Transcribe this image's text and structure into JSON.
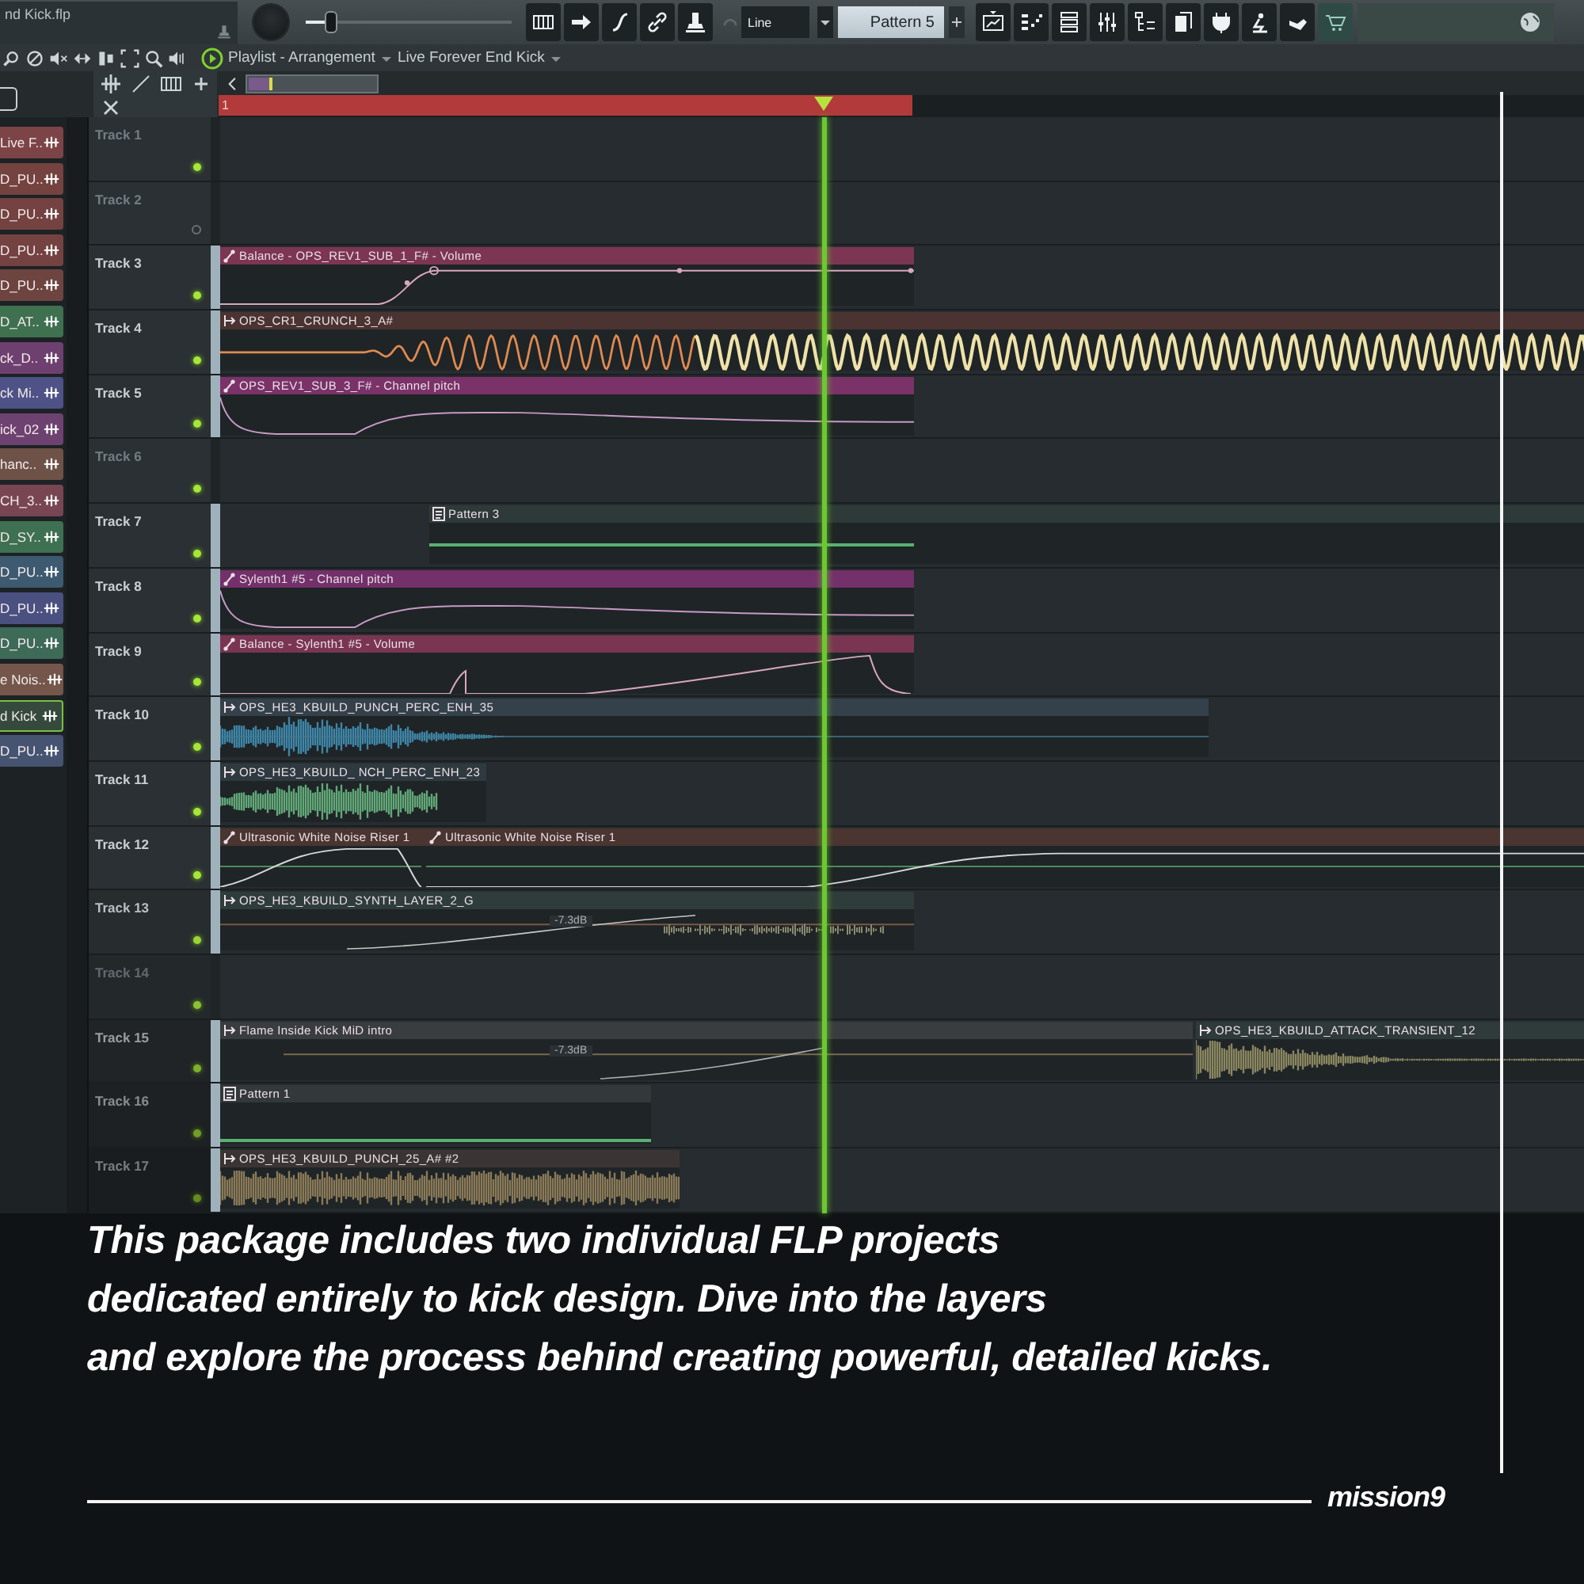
{
  "project": {
    "file_name": "nd Kick.flp"
  },
  "toolbar": {
    "slider": {
      "level": 0.12
    },
    "snap_mode": "Line",
    "pattern": "Pattern 5"
  },
  "playlist": {
    "title": "Playlist - Arrangement",
    "arrangement": "Live Forever End Kick",
    "ruler_label": "1"
  },
  "channels": [
    {
      "name": "Live F..",
      "color": "#7c4446",
      "selected": false
    },
    {
      "name": "D_PU..",
      "color": "#74423f",
      "selected": false
    },
    {
      "name": "D_PU..",
      "color": "#744240",
      "selected": false
    },
    {
      "name": "D_PU..",
      "color": "#744241",
      "selected": false
    },
    {
      "name": "D_PU..",
      "color": "#6e4440",
      "selected": false
    },
    {
      "name": "D_AT..",
      "color": "#3f7050",
      "selected": false
    },
    {
      "name": "ck_D..",
      "color": "#6e4070",
      "selected": false
    },
    {
      "name": "ck Mi..",
      "color": "#4e5286",
      "selected": false
    },
    {
      "name": "ick_02",
      "color": "#6e4270",
      "selected": false
    },
    {
      "name": "hanc..",
      "color": "#6e5248",
      "selected": false
    },
    {
      "name": "CH_3..",
      "color": "#784652",
      "selected": false
    },
    {
      "name": "D_SY..",
      "color": "#3e7052",
      "selected": false
    },
    {
      "name": "D_PU..",
      "color": "#3d5a70",
      "selected": false
    },
    {
      "name": "D_PU..",
      "color": "#4a5080",
      "selected": false
    },
    {
      "name": "D_PU..",
      "color": "#3e6a58",
      "selected": false
    },
    {
      "name": "e Nois..",
      "color": "#74564a",
      "selected": false
    },
    {
      "name": "d Kick",
      "color": "#354a3c",
      "selected": true
    },
    {
      "name": "D_PU..",
      "color": "#465472",
      "selected": false
    }
  ],
  "tracks": [
    {
      "name": "Track 1",
      "led_on": true
    },
    {
      "name": "Track 2",
      "led_on": false
    },
    {
      "name": "Track 3",
      "led_on": true,
      "clips": [
        {
          "kind": "automation",
          "label": "Balance - OPS_REV1_SUB_1_F# - Volume",
          "color": "#7c3552"
        }
      ]
    },
    {
      "name": "Track 4",
      "led_on": true,
      "clips": [
        {
          "kind": "audio",
          "label": "OPS_CR1_CRUNCH_3_A#",
          "color": "#4a3330"
        }
      ]
    },
    {
      "name": "Track 5",
      "led_on": true,
      "clips": [
        {
          "kind": "automation",
          "label": "OPS_REV1_SUB_3_F# - Channel pitch",
          "color": "#7a3268"
        }
      ]
    },
    {
      "name": "Track 6",
      "led_on": true
    },
    {
      "name": "Track 7",
      "led_on": true,
      "clips": [
        {
          "kind": "pattern",
          "label": "Pattern 3",
          "color": "#2e3a38"
        }
      ]
    },
    {
      "name": "Track 8",
      "led_on": true,
      "clips": [
        {
          "kind": "automation",
          "label": "Sylenth1 #5 - Channel pitch",
          "color": "#73306a"
        }
      ]
    },
    {
      "name": "Track 9",
      "led_on": true,
      "clips": [
        {
          "kind": "automation",
          "label": "Balance - Sylenth1 #5 - Volume",
          "color": "#7a3552"
        }
      ]
    },
    {
      "name": "Track 10",
      "led_on": true,
      "clips": [
        {
          "kind": "audio",
          "label": "OPS_HE3_KBUILD_PUNCH_PERC_ENH_35",
          "color": "#34414a"
        }
      ]
    },
    {
      "name": "Track 11",
      "led_on": true,
      "clips": [
        {
          "kind": "audio",
          "label": "OPS_HE3_KBUILD_ NCH_PERC_ENH_23",
          "color": "#2e3a40"
        }
      ]
    },
    {
      "name": "Track 12",
      "led_on": true,
      "clips": [
        {
          "kind": "automation",
          "label": "Ultrasonic White Noise Riser 1",
          "color": "#4a3530"
        },
        {
          "kind": "automation",
          "label": "Ultrasonic White Noise Riser 1",
          "color": "#4a3531"
        }
      ]
    },
    {
      "name": "Track 13",
      "led_on": true,
      "clips": [
        {
          "kind": "audio",
          "label": "OPS_HE3_KBUILD_SYNTH_LAYER_2_G",
          "color": "#2f3d3a",
          "gain": "-7.3dB"
        }
      ]
    },
    {
      "name": "Track 14",
      "led_on": true
    },
    {
      "name": "Track 15",
      "led_on": true,
      "clips": [
        {
          "kind": "audio",
          "label": "Flame Inside Kick MiD intro",
          "color": "#3a3d40",
          "gain": "-7.3dB"
        },
        {
          "kind": "audio",
          "label": "OPS_HE3_KBUILD_ATTACK_TRANSIENT_12",
          "color": "#2f3a3a"
        }
      ]
    },
    {
      "name": "Track 16",
      "led_on": true,
      "clips": [
        {
          "kind": "pattern",
          "label": "Pattern 1",
          "color": "#33383a"
        }
      ]
    },
    {
      "name": "Track 17",
      "led_on": true,
      "clips": [
        {
          "kind": "audio",
          "label": "OPS_HE3_KBUILD_PUNCH_25_A# #2",
          "color": "#3a3533"
        }
      ]
    }
  ],
  "caption": {
    "lines": [
      "This package includes two individual FLP projects",
      "dedicated entirely to kick design. Dive into the layers",
      "and explore the process behind creating powerful, detailed kicks."
    ]
  },
  "brand": {
    "logo": "mission9"
  }
}
